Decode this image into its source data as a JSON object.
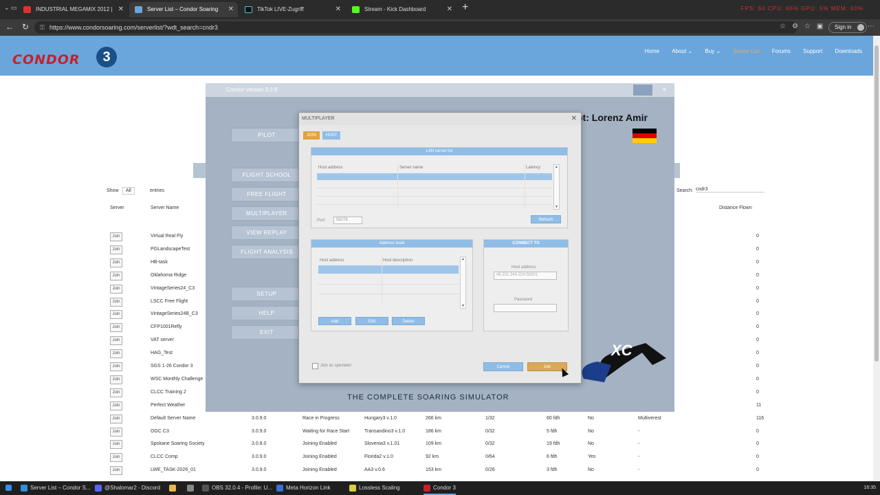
{
  "browser": {
    "tabs": [
      {
        "label": "INDUSTRIAL MEGAMIX 2012 | ",
        "icon_color": "#e03030",
        "icon": "youtube-icon"
      },
      {
        "label": "Server List – Condor Soaring",
        "icon_color": "#6aa6dc",
        "icon": "condor-icon",
        "active": true
      },
      {
        "label": "TikTok LIVE-Zugriff",
        "icon_color": "#111111",
        "icon": "tiktok-icon"
      },
      {
        "label": "Stream - Kick Dashboard",
        "icon_color": "#53fc18",
        "icon": "kick-icon"
      }
    ],
    "url": "https://www.condorsoaring.com/serverlist/?wdt_search=cndr3",
    "sign_in_label": "Sign in",
    "recording_indicators": "FPS: 60  CPU: 66%  GPU: 5%  MEM: 60%"
  },
  "site": {
    "logo_text": "CONDOR",
    "logo_number": "3",
    "brand_color": "#c8202a",
    "header_color": "#6aa6dc",
    "menu": [
      "Home",
      "About ⌄",
      "Buy ⌄",
      "Server List",
      "Forums",
      "Support",
      "Downloads"
    ],
    "show_label": "Show",
    "show_value": "All",
    "entries_label": "entries",
    "search_label": "Search:",
    "search_value": "cndr3",
    "columns": {
      "server": "Server",
      "server_name": "Server Name",
      "distance": "Distance Flown"
    },
    "join_label": "Join",
    "rows": [
      {
        "name": "Virtual Real Fly",
        "version": "",
        "status": "",
        "task": "",
        "distance": "",
        "slots": "",
        "speed": "",
        "pw": "",
        "flag": "",
        "count": "0"
      },
      {
        "name": "PGLandscapeTest",
        "version": "",
        "status": "",
        "task": "",
        "distance": "",
        "slots": "",
        "speed": "",
        "pw": "",
        "flag": "",
        "count": "0"
      },
      {
        "name": "HB-task",
        "version": "",
        "status": "",
        "task": "",
        "distance": "",
        "slots": "",
        "speed": "",
        "pw": "",
        "flag": "",
        "count": "0"
      },
      {
        "name": "Oklahoma Ridge",
        "version": "",
        "status": "",
        "task": "",
        "distance": "",
        "slots": "",
        "speed": "",
        "pw": "",
        "flag": "",
        "count": "0"
      },
      {
        "name": "VintageSeries24_C3",
        "version": "",
        "status": "",
        "task": "",
        "distance": "",
        "slots": "",
        "speed": "",
        "pw": "",
        "flag": "",
        "count": "0"
      },
      {
        "name": "LSCC Free Flight",
        "version": "",
        "status": "",
        "task": "",
        "distance": "",
        "slots": "",
        "speed": "",
        "pw": "",
        "flag": "",
        "count": "0"
      },
      {
        "name": "VintageSeries24B_C3",
        "version": "",
        "status": "",
        "task": "",
        "distance": "",
        "slots": "",
        "speed": "",
        "pw": "",
        "flag": "",
        "count": "0"
      },
      {
        "name": "CFP1001Refly",
        "version": "",
        "status": "",
        "task": "",
        "distance": "",
        "slots": "",
        "speed": "",
        "pw": "",
        "flag": "",
        "count": "0"
      },
      {
        "name": "VAT server",
        "version": "",
        "status": "",
        "task": "",
        "distance": "",
        "slots": "",
        "speed": "",
        "pw": "",
        "flag": "",
        "count": "0"
      },
      {
        "name": "HAG_Test",
        "version": "",
        "status": "",
        "task": "",
        "distance": "",
        "slots": "",
        "speed": "",
        "pw": "",
        "flag": "",
        "count": "0"
      },
      {
        "name": "SGS 1-26 Condor 3",
        "version": "",
        "status": "",
        "task": "",
        "distance": "",
        "slots": "",
        "speed": "",
        "pw": "",
        "flag": "",
        "count": "0"
      },
      {
        "name": "WSC Monthly Challenge",
        "version": "",
        "status": "",
        "task": "",
        "distance": "",
        "slots": "",
        "speed": "",
        "pw": "",
        "flag": "",
        "count": "0"
      },
      {
        "name": "CLCC Training 2",
        "version": "",
        "status": "",
        "task": "",
        "distance": "",
        "slots": "",
        "speed": "",
        "pw": "",
        "flag": "",
        "count": "0"
      },
      {
        "name": "Perfect Weather",
        "version": "",
        "status": "",
        "task": "",
        "distance": "",
        "slots": "",
        "speed": "",
        "pw": "",
        "flag": "",
        "count": "11"
      },
      {
        "name": "Default Server Name",
        "version": "3.0.9.0",
        "status": "Race in Progress",
        "task": "Hungary3 v.1.0",
        "distance": "266 km",
        "slots": "1/32",
        "speed": "60 fdh",
        "pw": "No",
        "flag": "Multiverest",
        "count": "116"
      },
      {
        "name": "OGC C3",
        "version": "3.0.9.0",
        "status": "Waiting for Race Start",
        "task": "Transandino3 v.1.0",
        "distance": "186 km",
        "slots": "0/32",
        "speed": "5 fdh",
        "pw": "No",
        "flag": "-",
        "count": "0"
      },
      {
        "name": "Spokane Soaring Society",
        "version": "3.0.8.0",
        "status": "Joining Enabled",
        "task": "Slovenia3 v.1.01",
        "distance": "109 km",
        "slots": "0/32",
        "speed": "19 fdh",
        "pw": "No",
        "flag": "-",
        "count": "0"
      },
      {
        "name": "CLCC Comp",
        "version": "3.0.9.0",
        "status": "Joining Enabled",
        "task": "Florida2 v.1.0",
        "distance": "92 km",
        "slots": "0/64",
        "speed": "6 fdh",
        "pw": "Yes",
        "flag": "-",
        "count": "0"
      },
      {
        "name": "LWE_TASK-2026_01",
        "version": "3.0.9.0",
        "status": "Joining Enabled",
        "task": "AA3 v.0.6",
        "distance": "153 km",
        "slots": "0/26",
        "speed": "3 fdh",
        "pw": "No",
        "flag": "-",
        "count": "0"
      }
    ]
  },
  "condor": {
    "window_title": "Condor version 3.0.9",
    "menu": [
      "PILOT",
      "FLIGHT SCHOOL",
      "FREE FLIGHT",
      "MULTIPLAYER",
      "VIEW REPLAY",
      "FLIGHT ANALYSIS",
      "SETUP",
      "HELP",
      "EXIT"
    ],
    "pilot_label": "ot: Lorenz Amir",
    "tagline": "THE COMPLETE SOARING SIMULATOR",
    "xc_label": "XC"
  },
  "dialog": {
    "title": "MULTIPLAYER",
    "tabs": [
      "JOIN",
      "HOST"
    ],
    "lan_title": "LAN server list",
    "lan_cols": [
      "Host address",
      "Server name",
      "Latency"
    ],
    "port_label": "Port:",
    "port_value": "56278",
    "refresh_label": "Refresh",
    "address_book_title": "Address book",
    "ab_cols": [
      "Host address",
      "Host description"
    ],
    "add_label": "Add",
    "edit_label": "Edit",
    "delete_label": "Delete",
    "connect_title": "CONNECT TO",
    "host_address_label": "Host address",
    "host_address_value": "46.231.240.224:56301",
    "password_label": "Password",
    "password_value": "",
    "spectator_label": "Join as spectator",
    "cancel_label": "Cancel",
    "join_label": "Join",
    "join_color": "#d9a85a",
    "accent_color": "#8fbde6"
  },
  "taskbar": {
    "items": [
      {
        "label": "Server List – Condor S...",
        "icon": "edge-icon",
        "color": "#2f8fd8"
      },
      {
        "label": "@Shalomar2 - Discord",
        "icon": "discord-icon",
        "color": "#5865f2"
      },
      {
        "label": "",
        "icon": "folder-icon",
        "color": "#e8b84a"
      },
      {
        "label": "",
        "icon": "app-icon",
        "color": "#888888"
      },
      {
        "label": "OBS 32.0.4 - Profile: U...",
        "icon": "obs-icon",
        "color": "#555555"
      },
      {
        "label": "Meta Horizon Link",
        "icon": "meta-icon",
        "color": "#3a6fd8"
      },
      {
        "label": "Lossless Scaling",
        "icon": "lossless-icon",
        "color": "#d8d040"
      },
      {
        "label": "Condor 3",
        "icon": "condor-icon",
        "color": "#c8202a",
        "active": true
      }
    ],
    "clock": "16:35"
  }
}
